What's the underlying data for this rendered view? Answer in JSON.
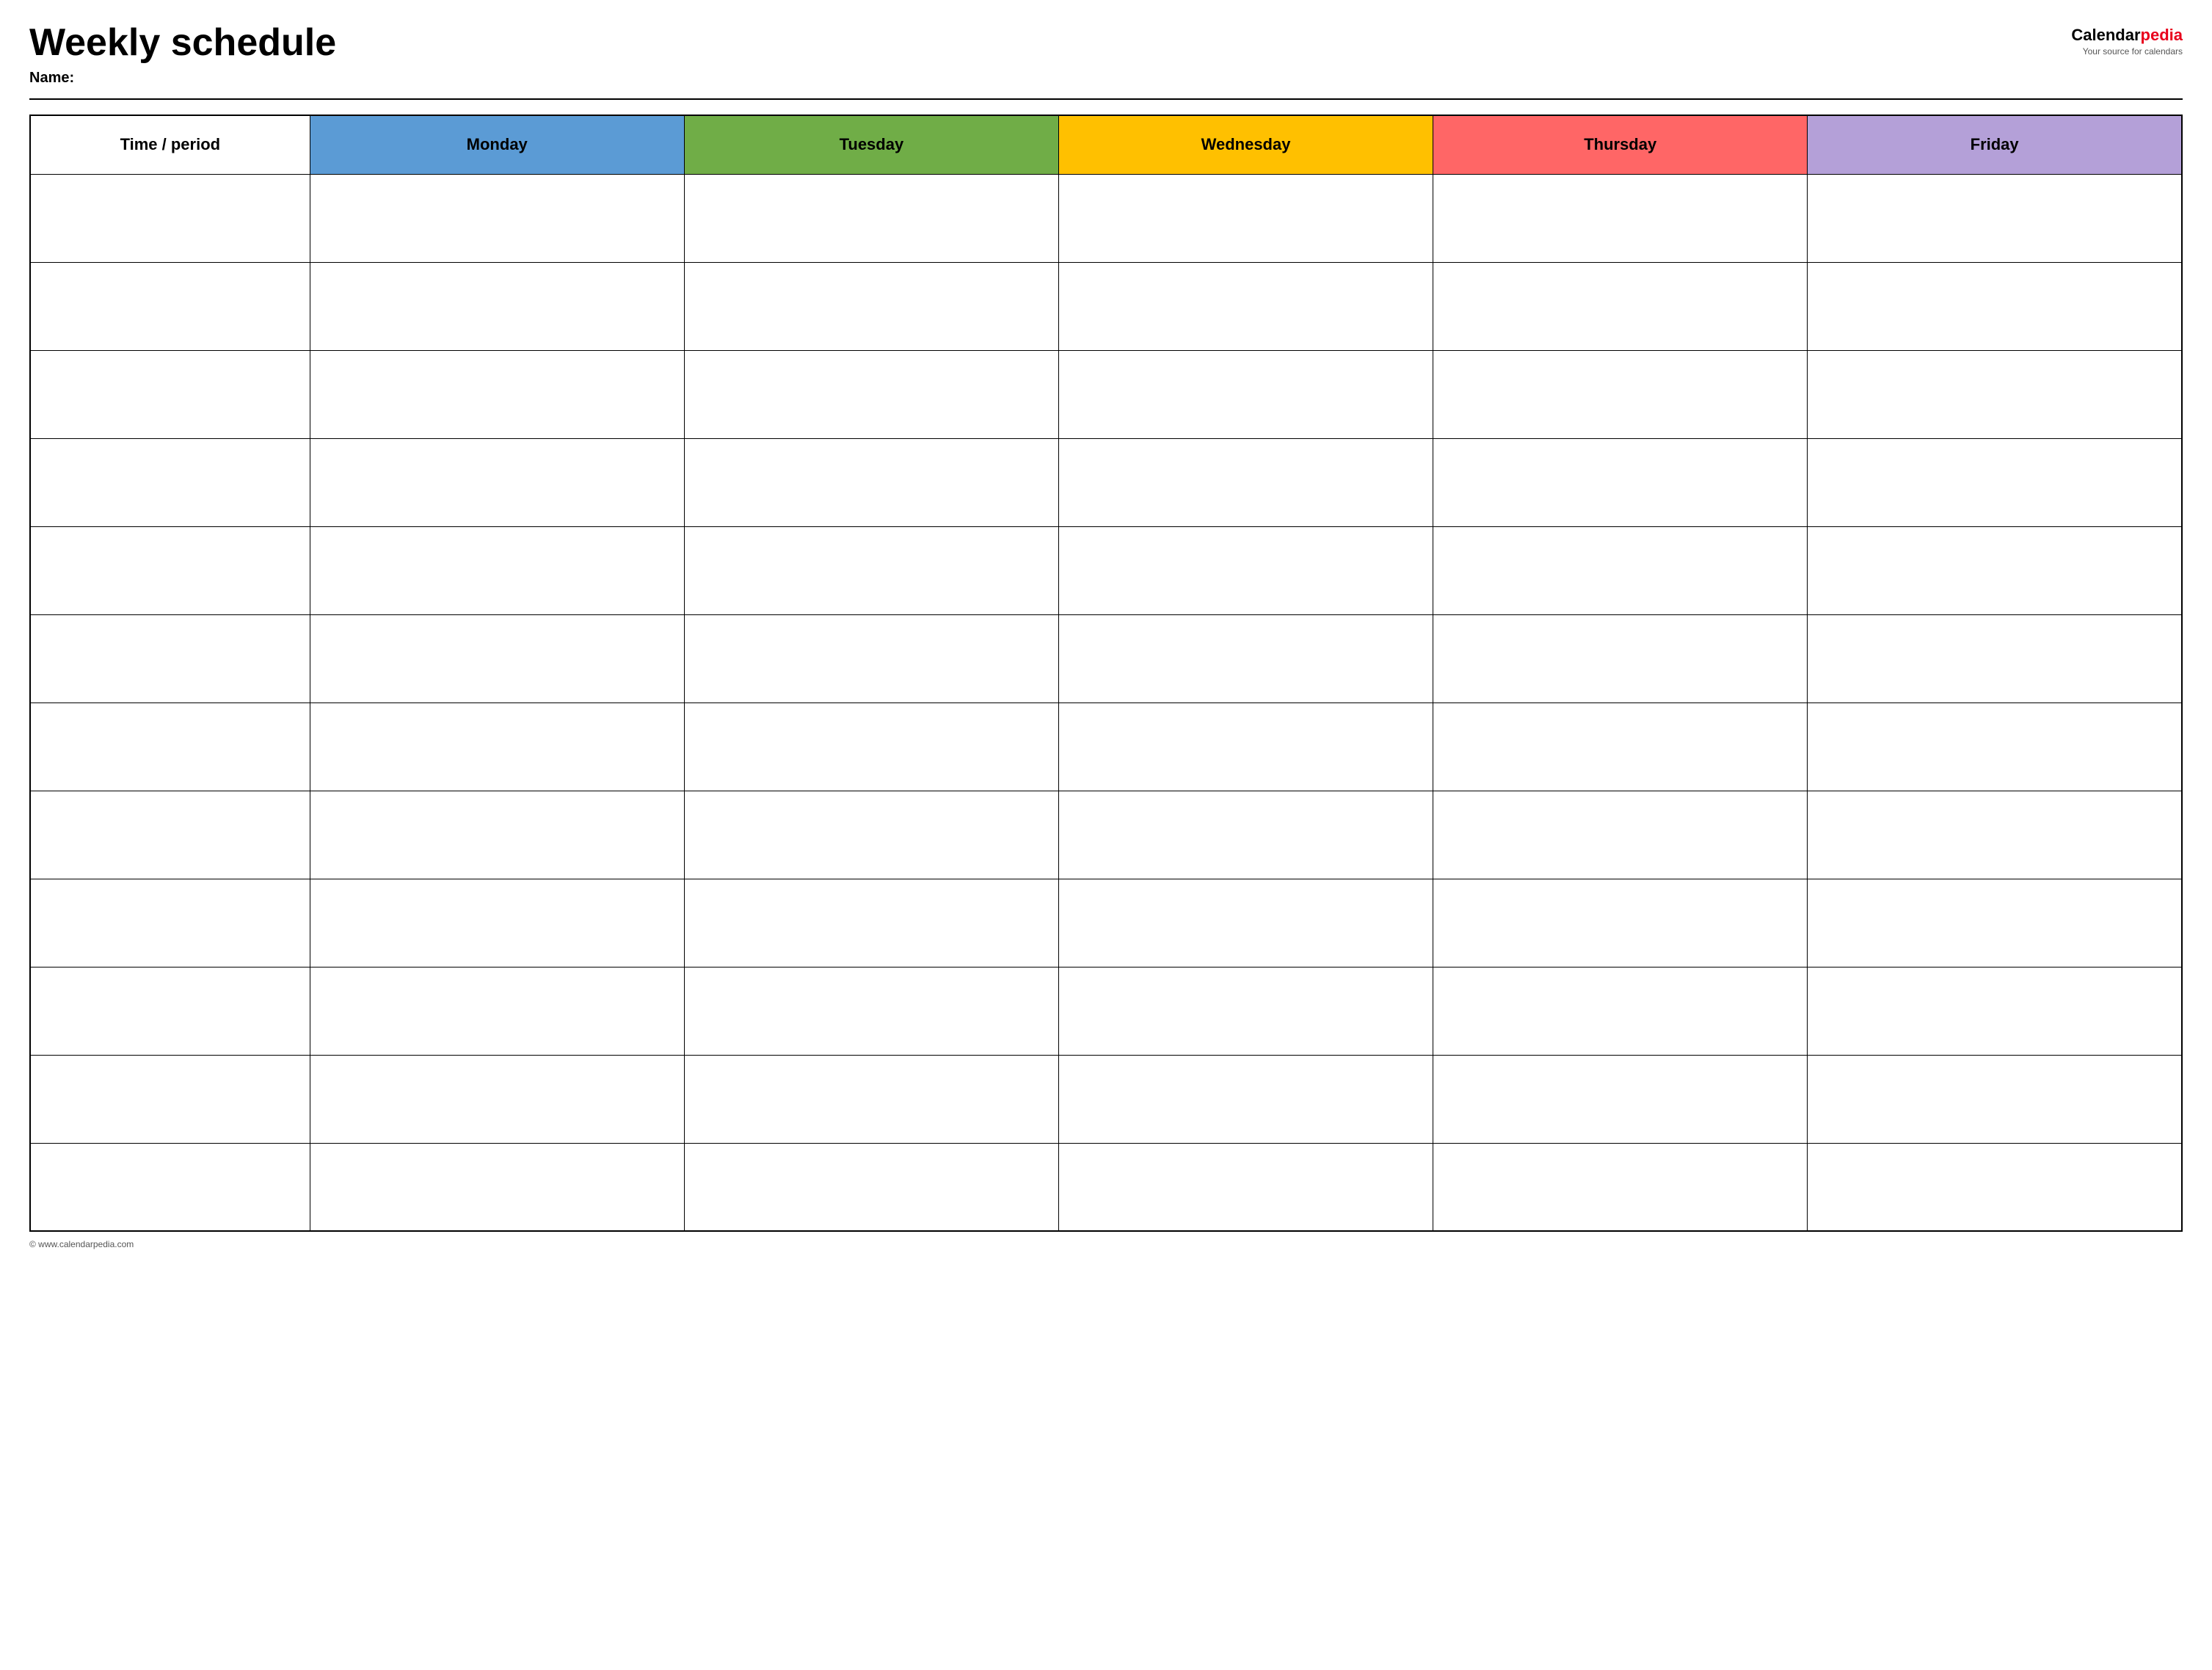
{
  "header": {
    "title": "Weekly schedule",
    "name_label": "Name:",
    "logo_calendar": "Calendar",
    "logo_pedia": "pedia",
    "logo_tagline": "Your source for calendars"
  },
  "table": {
    "columns": [
      {
        "id": "time",
        "label": "Time / period",
        "color": "#ffffff"
      },
      {
        "id": "monday",
        "label": "Monday",
        "color": "#5b9bd5"
      },
      {
        "id": "tuesday",
        "label": "Tuesday",
        "color": "#70ad47"
      },
      {
        "id": "wednesday",
        "label": "Wednesday",
        "color": "#ffc000"
      },
      {
        "id": "thursday",
        "label": "Thursday",
        "color": "#ff6666"
      },
      {
        "id": "friday",
        "label": "Friday",
        "color": "#b4a0d8"
      }
    ],
    "row_count": 12
  },
  "footer": {
    "copyright": "© www.calendarpedia.com"
  }
}
